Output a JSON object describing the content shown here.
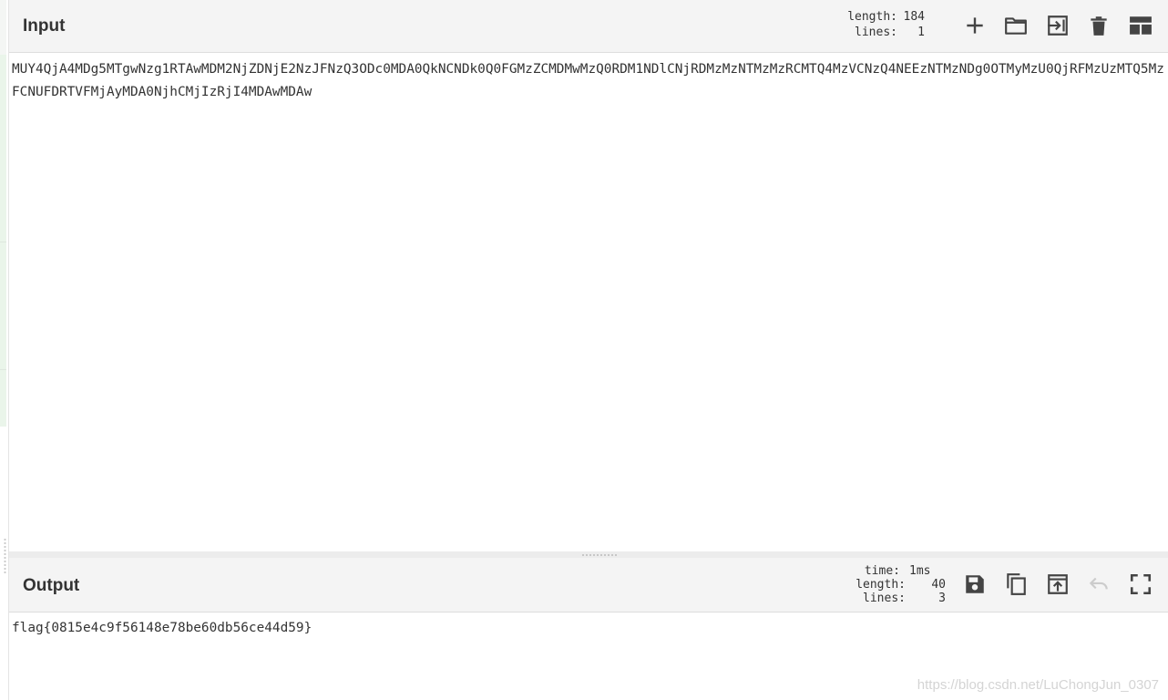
{
  "input": {
    "title": "Input",
    "stats": {
      "length_label": "length:",
      "length_value": "184",
      "lines_label": "lines:",
      "lines_value": "1"
    },
    "text": "MUY4QjA4MDg5MTgwNzg1RTAwMDM2NjZDNjE2NzJFNzQ3ODc0MDA0QkNCNDk0Q0FGMzZCMDMwMzQ0RDM1NDlCNjRDMzMzNTMzMzRCMTQ4MzVCNzQ4NEEzNTMzNDg0OTMyMzU0QjRFMzUzMTQ5MzFCNUFDRTVFMjAyMDA0NjhCMjIzRjI4MDAwMDAw",
    "icons": [
      "plus-icon",
      "folder-icon",
      "import-icon",
      "trash-icon",
      "layout-icon"
    ]
  },
  "output": {
    "title": "Output",
    "stats": {
      "time_label": "time:",
      "time_value": "1ms",
      "length_label": "length:",
      "length_value": "40",
      "lines_label": "lines:",
      "lines_value": "3"
    },
    "text": "flag{0815e4c9f56148e78be60db56ce44d59}",
    "icons": [
      "save-icon",
      "copy-icon",
      "replace-input-icon",
      "undo-icon",
      "fullscreen-icon"
    ]
  },
  "watermark": "https://blog.csdn.net/LuChongJun_0307"
}
